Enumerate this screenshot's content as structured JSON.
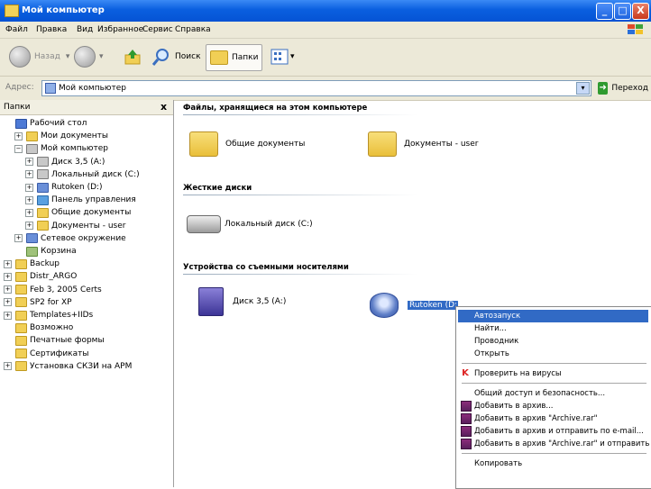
{
  "window": {
    "title": "Мой компьютер",
    "buttons": [
      "_",
      "□",
      "X"
    ]
  },
  "menu": [
    "Файл",
    "Правка",
    "Вид",
    "Избранное",
    "Сервис",
    "Справка"
  ],
  "toolbar": {
    "back": "Назад",
    "search": "Поиск",
    "folders": "Папки",
    "views": "▾"
  },
  "address": {
    "label": "Адрес:",
    "value": "Мой компьютер",
    "go": "Переход"
  },
  "left_pane": {
    "title": "Папки",
    "close": "x",
    "tree": [
      {
        "label": "Рабочий стол",
        "exp": "",
        "icon": "desk",
        "indent": 0
      },
      {
        "label": "Мои документы",
        "exp": "+",
        "icon": "folder",
        "indent": 1
      },
      {
        "label": "Мой компьютер",
        "exp": "−",
        "icon": "drive",
        "indent": 1
      },
      {
        "label": "Диск 3,5 (A:)",
        "exp": "+",
        "icon": "drive",
        "indent": 2
      },
      {
        "label": "Локальный диск (C:)",
        "exp": "+",
        "icon": "drive",
        "indent": 2
      },
      {
        "label": "Rutoken (D:)",
        "exp": "+",
        "icon": "blue",
        "indent": 2
      },
      {
        "label": "Панель управления",
        "exp": "+",
        "icon": "cpanel",
        "indent": 2
      },
      {
        "label": "Общие документы",
        "exp": "+",
        "icon": "folder",
        "indent": 2
      },
      {
        "label": "Документы - user",
        "exp": "+",
        "icon": "folder",
        "indent": 2
      },
      {
        "label": "Сетевое окружение",
        "exp": "+",
        "icon": "blue",
        "indent": 1
      },
      {
        "label": "Корзина",
        "exp": "",
        "icon": "bin",
        "indent": 1
      },
      {
        "label": "Backup",
        "exp": "+",
        "icon": "folder",
        "indent": 0
      },
      {
        "label": "Distr_ARGO",
        "exp": "+",
        "icon": "folder",
        "indent": 0
      },
      {
        "label": "Feb 3, 2005 Certs",
        "exp": "+",
        "icon": "folder",
        "indent": 0
      },
      {
        "label": "SP2 for XP",
        "exp": "+",
        "icon": "folder",
        "indent": 0
      },
      {
        "label": "Templates+IIDs",
        "exp": "+",
        "icon": "folder",
        "indent": 0
      },
      {
        "label": "Возможно",
        "exp": "",
        "icon": "folder",
        "indent": 0
      },
      {
        "label": "Печатные формы",
        "exp": "",
        "icon": "folder",
        "indent": 0
      },
      {
        "label": "Сертификаты",
        "exp": "",
        "icon": "folder",
        "indent": 0
      },
      {
        "label": "Установка СКЗИ на АРМ",
        "exp": "+",
        "icon": "folder",
        "indent": 0
      }
    ]
  },
  "right_pane": {
    "sections": [
      {
        "title": "Файлы, хранящиеся на этом компьютере",
        "items": [
          {
            "label": "Общие документы",
            "icon": "folder"
          },
          {
            "label": "Документы - user",
            "icon": "folder"
          }
        ]
      },
      {
        "title": "Жесткие диски",
        "items": [
          {
            "label": "Локальный диск (C:)",
            "icon": "harddisk"
          }
        ]
      },
      {
        "title": "Устройства со съемными носителями",
        "items": [
          {
            "label": "Диск 3,5 (A:)",
            "icon": "floppy"
          },
          {
            "label": "Rutoken (D:)",
            "icon": "cdrom"
          }
        ]
      }
    ]
  },
  "context_menu": {
    "items": [
      {
        "label": "Автозапуск",
        "selected": true,
        "icon": ""
      },
      {
        "label": "Найти...",
        "icon": ""
      },
      {
        "label": "Проводник",
        "icon": ""
      },
      {
        "label": "Открыть",
        "icon": ""
      },
      {
        "sep": true
      },
      {
        "label": "Проверить на вирусы",
        "icon": "virus"
      },
      {
        "sep": true
      },
      {
        "label": "Общий доступ и безопасность...",
        "icon": ""
      },
      {
        "label": "Добавить в архив...",
        "icon": "rar"
      },
      {
        "label": "Добавить в архив \"Archive.rar\"",
        "icon": "rar"
      },
      {
        "label": "Добавить в архив и отправить по e-mail...",
        "icon": "rar"
      },
      {
        "label": "Добавить в архив \"Archive.rar\" и отправить",
        "icon": "rar"
      },
      {
        "sep": true
      },
      {
        "label": "Копировать",
        "icon": ""
      }
    ]
  }
}
